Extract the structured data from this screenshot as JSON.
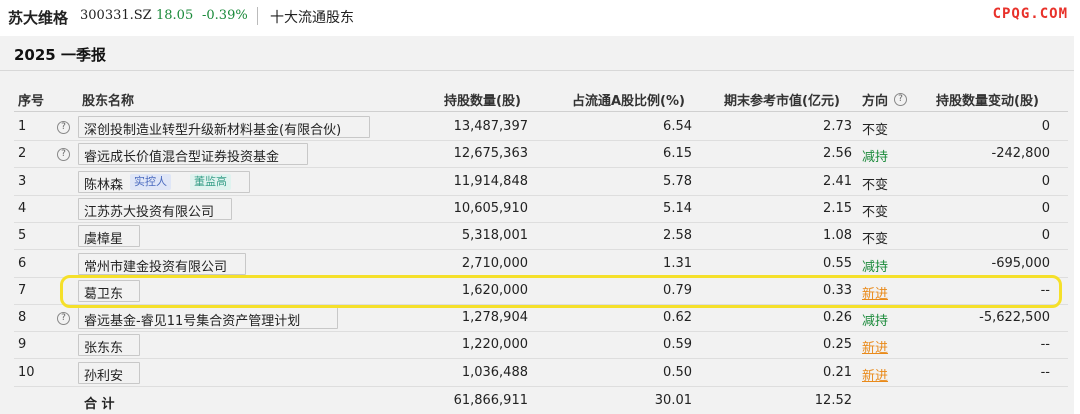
{
  "header": {
    "stock_name": "苏大维格",
    "stock_code": "300331.SZ",
    "price": "18.05",
    "change": "-0.39%",
    "section": "十大流通股东",
    "watermark": "CPQG.COM"
  },
  "report": {
    "period": "2025 一季报"
  },
  "table": {
    "columns": [
      "序号",
      "股东名称",
      "持股数量(股)",
      "占流通A股比例(%)",
      "期末参考市值(亿元)",
      "方向",
      "持股数量变动(股)"
    ],
    "rows": [
      {
        "idx": "1",
        "name": "深创投制造业转型升级新材料基金(有限合伙)",
        "shares": "13,487,397",
        "ratio": "6.54",
        "value": "2.73",
        "direction": "不变",
        "change": "0",
        "help": true
      },
      {
        "idx": "2",
        "name": "睿远成长价值混合型证券投资基金",
        "shares": "12,675,363",
        "ratio": "6.15",
        "value": "2.56",
        "direction": "减持",
        "change": "-242,800",
        "help": true
      },
      {
        "idx": "3",
        "name": "陈林森",
        "shares": "11,914,848",
        "ratio": "5.78",
        "value": "2.41",
        "direction": "不变",
        "change": "0",
        "tags": [
          "实控人",
          "董监高"
        ]
      },
      {
        "idx": "4",
        "name": "江苏苏大投资有限公司",
        "shares": "10,605,910",
        "ratio": "5.14",
        "value": "2.15",
        "direction": "不变",
        "change": "0"
      },
      {
        "idx": "5",
        "name": "虞樟星",
        "shares": "5,318,001",
        "ratio": "2.58",
        "value": "1.08",
        "direction": "不变",
        "change": "0"
      },
      {
        "idx": "6",
        "name": "常州市建金投资有限公司",
        "shares": "2,710,000",
        "ratio": "1.31",
        "value": "0.55",
        "direction": "减持",
        "change": "-695,000"
      },
      {
        "idx": "7",
        "name": "葛卫东",
        "shares": "1,620,000",
        "ratio": "0.79",
        "value": "0.33",
        "direction": "新进",
        "change": "--"
      },
      {
        "idx": "8",
        "name": "睿远基金-睿见11号集合资产管理计划",
        "shares": "1,278,904",
        "ratio": "0.62",
        "value": "0.26",
        "direction": "减持",
        "change": "-5,622,500",
        "help": true
      },
      {
        "idx": "9",
        "name": "张东东",
        "shares": "1,220,000",
        "ratio": "0.59",
        "value": "0.25",
        "direction": "新进",
        "change": "--"
      },
      {
        "idx": "10",
        "name": "孙利安",
        "shares": "1,036,488",
        "ratio": "0.50",
        "value": "0.21",
        "direction": "新进",
        "change": "--"
      }
    ],
    "total": {
      "label": "合 计",
      "shares": "61,866,911",
      "ratio": "30.01",
      "value": "12.52"
    }
  },
  "colors": {
    "decrease": "#1a8a3a",
    "new": "#e98a1a",
    "highlight": "#f5e02a"
  }
}
